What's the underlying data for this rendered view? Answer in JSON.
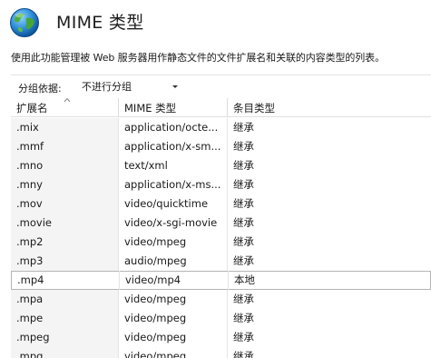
{
  "header": {
    "title": "MIME 类型",
    "icon": "globe-icon"
  },
  "description": "使用此功能管理被 Web 服务器用作静态文件的文件扩展名和关联的内容类型的列表。",
  "toolbar": {
    "group_label": "分组依据:",
    "group_value": "不进行分组"
  },
  "table": {
    "columns": [
      "扩展名",
      "MIME 类型",
      "条目类型"
    ],
    "sorted_column": "扩展名",
    "sort_direction": "ascending",
    "selected_row": ".mp4",
    "rows": [
      [
        ".mix",
        "application/octe...",
        "继承"
      ],
      [
        ".mmf",
        "application/x-sm...",
        "继承"
      ],
      [
        ".mno",
        "text/xml",
        "继承"
      ],
      [
        ".mny",
        "application/x-ms...",
        "继承"
      ],
      [
        ".mov",
        "video/quicktime",
        "继承"
      ],
      [
        ".movie",
        "video/x-sgi-movie",
        "继承"
      ],
      [
        ".mp2",
        "video/mpeg",
        "继承"
      ],
      [
        ".mp3",
        "audio/mpeg",
        "继承"
      ],
      [
        ".mp4",
        "video/mp4",
        "本地"
      ],
      [
        ".mpa",
        "video/mpeg",
        "继承"
      ],
      [
        ".mpe",
        "video/mpeg",
        "继承"
      ],
      [
        ".mpeg",
        "video/mpeg",
        "继承"
      ],
      [
        ".mpg",
        "video/mpeg",
        "继承"
      ]
    ]
  }
}
